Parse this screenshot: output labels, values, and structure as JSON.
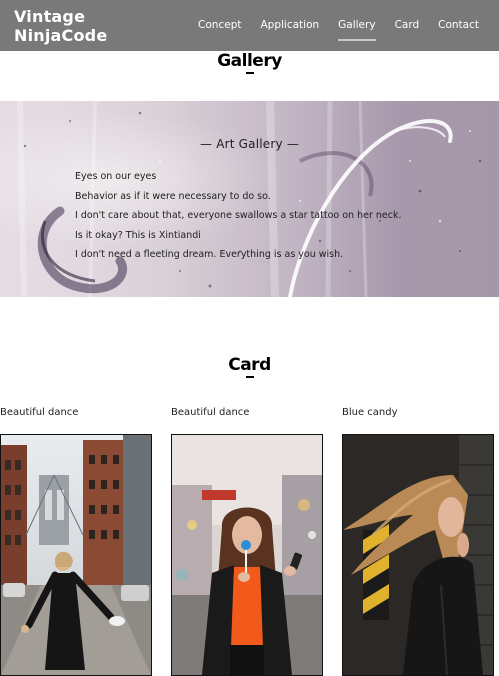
{
  "header": {
    "brand": "Vintage NinjaCode",
    "nav": [
      {
        "label": "Concept",
        "active": false
      },
      {
        "label": "Application",
        "active": false
      },
      {
        "label": "Gallery",
        "active": true
      },
      {
        "label": "Card",
        "active": false
      },
      {
        "label": "Contact",
        "active": false
      }
    ]
  },
  "gallery": {
    "title": "Gallery",
    "banner_title": "— Art Gallery —",
    "lines": [
      "Eyes on our eyes",
      "Behavior as if it were necessary to do so.",
      "I don't care about that, everyone swallows a star tattoo on her neck.",
      "Is it okay? This is Xintiandi",
      "I don't need a fleeting dream. Everything is as you wish."
    ]
  },
  "card_section": {
    "title": "Card",
    "cards": [
      {
        "label": "Beautiful dance",
        "photo": "city-street-dancer-photo"
      },
      {
        "label": "Beautiful dance",
        "photo": "woman-with-lollipop-photo"
      },
      {
        "label": "Blue candy",
        "photo": "woman-against-wall-photo"
      }
    ]
  }
}
